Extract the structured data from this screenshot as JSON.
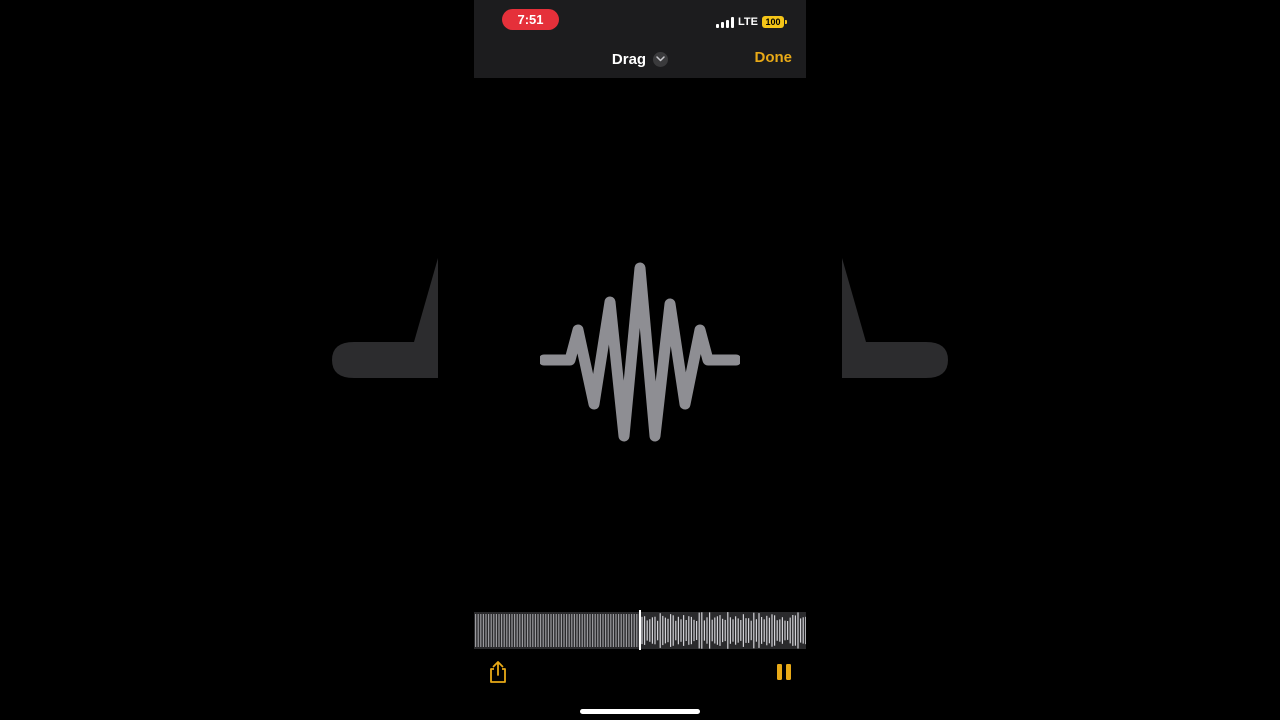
{
  "status_bar": {
    "time": "7:51",
    "network": "LTE",
    "battery": "100"
  },
  "header": {
    "title": "Drag",
    "done_label": "Done"
  },
  "icons": {
    "title_chevron": "chevron-down-icon",
    "center": "waveform-icon",
    "share": "share-icon",
    "pause": "pause-icon"
  },
  "colors": {
    "accent": "#e8a917",
    "recording_pill": "#e5303a",
    "waveform_icon": "#8e8e93",
    "header_bg": "#1c1c1e"
  },
  "playback": {
    "position_fraction": 0.5
  }
}
